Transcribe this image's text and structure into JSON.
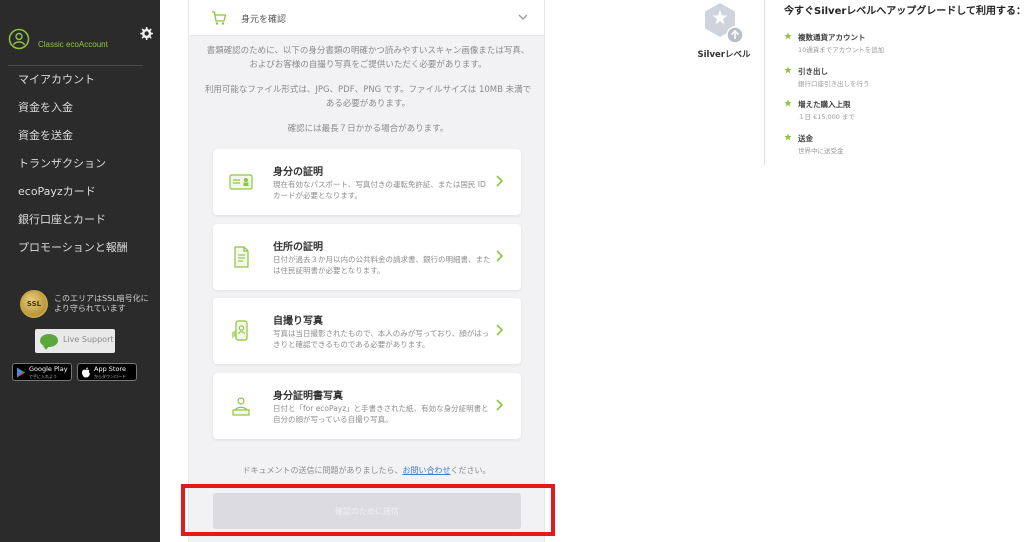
{
  "sidebar": {
    "account_label": "Classic ecoAccount",
    "menu": [
      "マイアカウント",
      "資金を入金",
      "資金を送金",
      "トランザクション",
      "ecoPayzカード",
      "銀行口座とカード",
      "プロモーションと報酬"
    ],
    "ssl_badge": "SSL",
    "ssl_text": "このエリアはSSL暗号化により守られています",
    "live_support": "Live Support",
    "google_play": {
      "label": "Google Play",
      "sub": "で手に入れよう"
    },
    "app_store": {
      "label": "App Store",
      "sub": "からダウンロード"
    }
  },
  "card": {
    "header_title": "身元を確認",
    "intro": [
      "書類確認のために、以下の身分書類の明確かつ読みやすいスキャン画像または写真、およびお客様の自撮り写真をご提供いただく必要があります。",
      "利用可能なファイル形式は、JPG、PDF、PNG です。ファイルサイズは 10MB 未満である必要があります。",
      "確認には最長７日かかる場合があります。"
    ],
    "documents": [
      {
        "title": "身分の証明",
        "desc": "現在有効なパスポート、写真付きの運転免許証、または国民 ID カードが必要となります。",
        "icon": "id-card-icon"
      },
      {
        "title": "住所の証明",
        "desc": "日付が過去３か月以内の公共料金の請求書、銀行の明細書、または住民証明書が必要となります。",
        "icon": "document-icon"
      },
      {
        "title": "自撮り写真",
        "desc": "写真は当日撮影されたもので、本人のみが写っており、顔がはっきりと確認できるものである必要があります。",
        "icon": "selfie-icon"
      },
      {
        "title": "身分証明書写真",
        "desc": "日付と「for ecoPayz」と手書きされた紙、有効な身分証明書と自分の顔が写っている自撮り写真。",
        "icon": "id-photo-icon"
      }
    ],
    "help_text": "ドキュメントの送信に問題がありましたら、",
    "help_link": "お問い合わせ",
    "help_suffix": "ください。",
    "submit_label": "確認のために送信"
  },
  "right": {
    "level_name": "Silverレベル",
    "upgrade_title": "今すぐSilverレベルへアップグレードして利用する：",
    "benefits": [
      {
        "title": "複数通貨アカウント",
        "sub": "10通貨までアカウントを追加"
      },
      {
        "title": "引き出し",
        "sub": "銀行口座引き出しを行う"
      },
      {
        "title": "増えた購入上限",
        "sub": "１日 €15,000 まで"
      },
      {
        "title": "送金",
        "sub": "世界中に送受金"
      }
    ]
  },
  "colors": {
    "accent_green": "#8cc63f",
    "sidebar_bg": "#2b2b2b",
    "highlight_red": "#e01b1b",
    "link_blue": "#3a7bd5"
  }
}
